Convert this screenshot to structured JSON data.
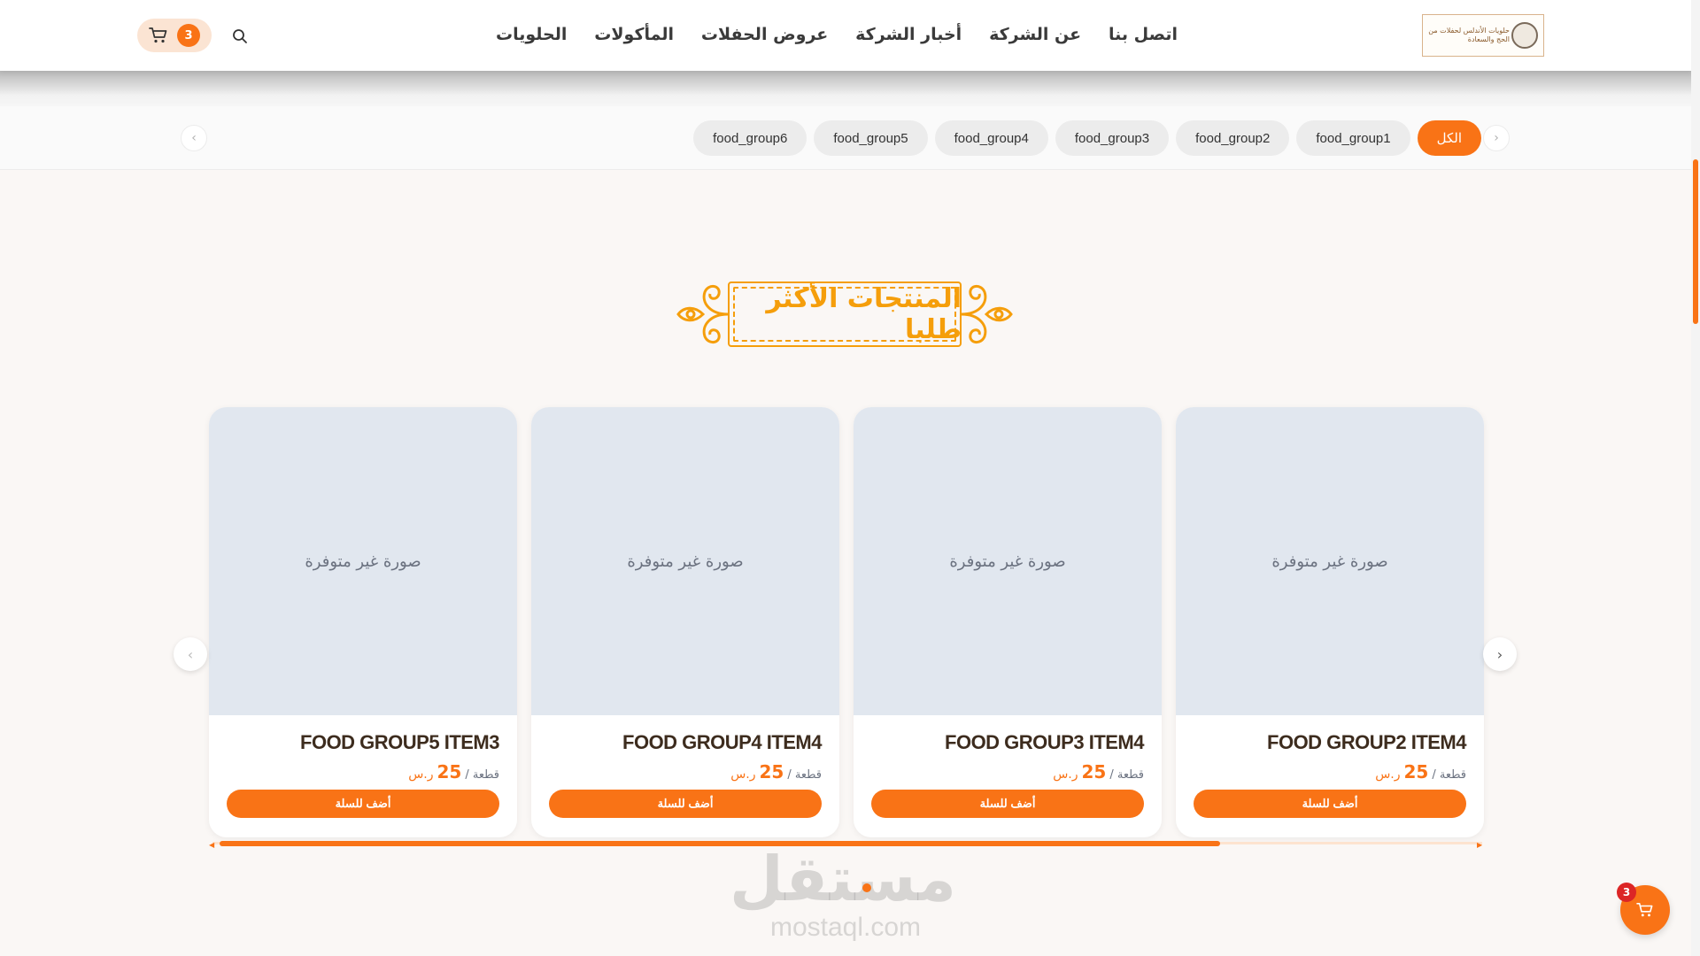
{
  "header": {
    "logo_text": "حلويات الأندلس لحفلات من الحج والسعادة",
    "nav": [
      {
        "label": "الحلويات"
      },
      {
        "label": "المأكولات"
      },
      {
        "label": "عروض الحفلات"
      },
      {
        "label": "أخبار الشركة"
      },
      {
        "label": "عن الشركة"
      },
      {
        "label": "اتصل بنا"
      }
    ],
    "search_icon": "search-icon",
    "cart": {
      "icon": "cart-icon",
      "count": "3"
    }
  },
  "categories": {
    "chips": [
      {
        "label": "الكل",
        "active": true
      },
      {
        "label": "food_group1"
      },
      {
        "label": "food_group2"
      },
      {
        "label": "food_group3"
      },
      {
        "label": "food_group4"
      },
      {
        "label": "food_group5"
      },
      {
        "label": "food_group6"
      }
    ],
    "prev_icon": "chevron-left-icon",
    "next_icon": "chevron-right-icon"
  },
  "section": {
    "title": "المنتجات الأكثر طلبا"
  },
  "products": [
    {
      "name": "FOOD GROUP2 ITEM4",
      "image_placeholder": "صورة غير متوفرة",
      "unit": "قطعة /",
      "price": "25",
      "currency": "ر.س",
      "button": "أضف للسلة"
    },
    {
      "name": "FOOD GROUP3 ITEM4",
      "image_placeholder": "صورة غير متوفرة",
      "unit": "قطعة /",
      "price": "25",
      "currency": "ر.س",
      "button": "أضف للسلة"
    },
    {
      "name": "FOOD GROUP4 ITEM4",
      "image_placeholder": "صورة غير متوفرة",
      "unit": "قطعة /",
      "price": "25",
      "currency": "ر.س",
      "button": "أضف للسلة"
    },
    {
      "name": "FOOD GROUP5 ITEM3",
      "image_placeholder": "صورة غير متوفرة",
      "unit": "قطعة /",
      "price": "25",
      "currency": "ر.س",
      "button": "أضف للسلة"
    }
  ],
  "watermark": {
    "ar": "مستقل",
    "en": "mostaql.com"
  },
  "floating_cart": {
    "count": "3",
    "icon": "cart-icon"
  },
  "colors": {
    "accent": "#f97316",
    "title_gold": "#f59e0b",
    "badge_red": "#dc2626",
    "placeholder_bg": "#e1e7ef"
  }
}
